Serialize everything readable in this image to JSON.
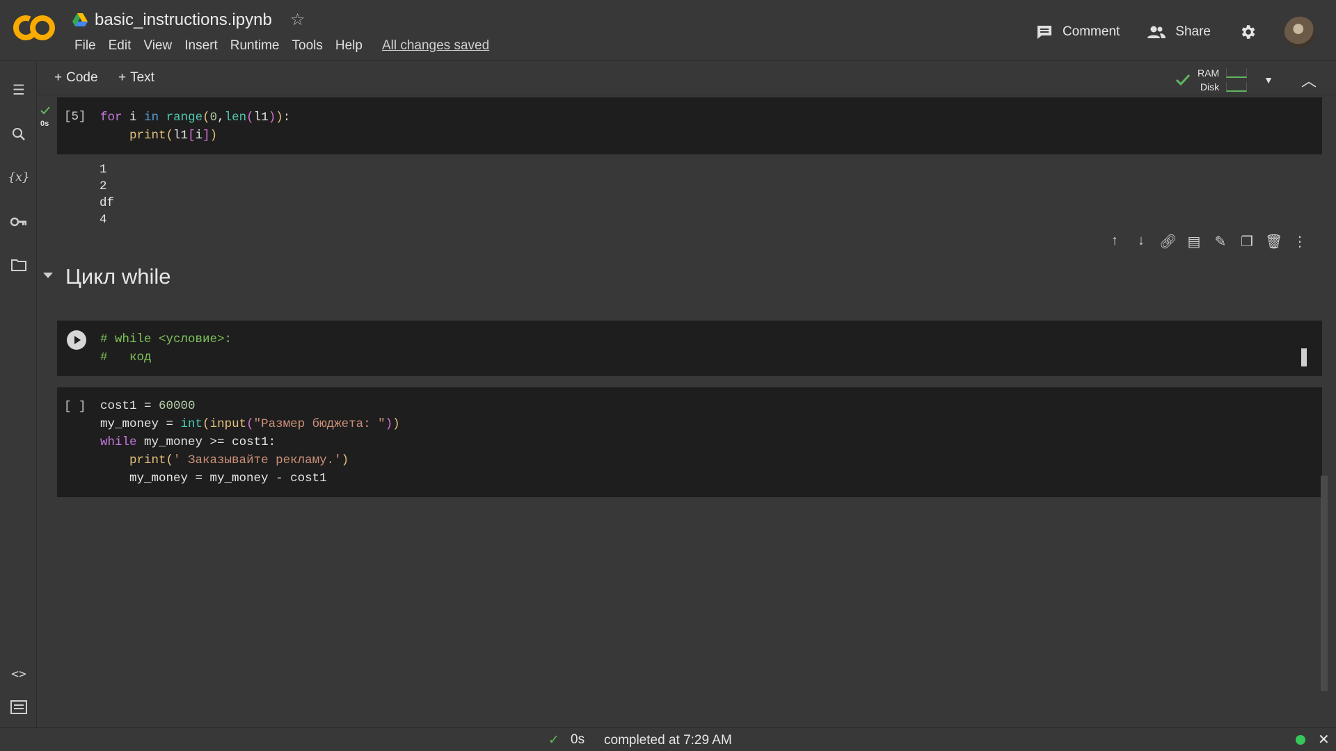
{
  "header": {
    "logo_text": "CO",
    "notebook_title": "basic_instructions.ipynb",
    "menu": [
      "File",
      "Edit",
      "View",
      "Insert",
      "Runtime",
      "Tools",
      "Help"
    ],
    "saved_status": "All changes saved",
    "comment_label": "Comment",
    "share_label": "Share"
  },
  "toolbar": {
    "add_code": "Code",
    "add_text": "Text",
    "ram_label": "RAM",
    "disk_label": "Disk"
  },
  "cell1": {
    "prompt": "[5]",
    "exec_time": "0s",
    "output": [
      "1",
      "2",
      "df",
      "4"
    ]
  },
  "text_cell": {
    "heading": "Цикл while"
  },
  "cell3": {
    "prompt": "[ ]"
  },
  "status_bar": {
    "duration": "0s",
    "message": "completed at 7:29 AM"
  },
  "colors": {
    "background": "#383838",
    "cell_background": "#1e1e1e",
    "logo_orange": "#f9ab00",
    "success_green": "#5fb85f"
  }
}
